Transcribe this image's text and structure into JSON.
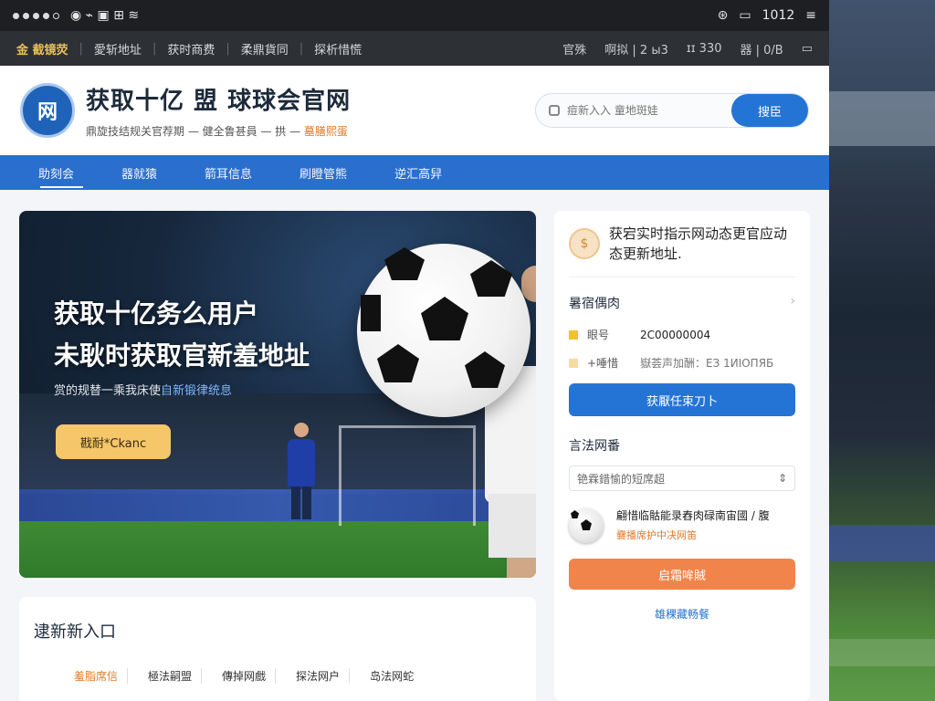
{
  "statusbar": {
    "left_icons": "◉ 令",
    "right_text": "（  ）  ,  図  1012",
    "right_time": "1012"
  },
  "topnav": {
    "brand": "金 截镜荧",
    "items": [
      "愛斩地址",
      "获时商费",
      "柔鼎貨同",
      "探析惜慌"
    ],
    "right_items": [
      "官殊",
      "啊拟 | 2 ы3",
      "ɪɪ 330",
      "器 | 0/B"
    ]
  },
  "header": {
    "logo_text": "网",
    "title": "获取十亿 盟 球球会官网",
    "subtitle_plain": "鼎旋技结规关官荐期 — 健全鲁甚員 — 拱 —",
    "subtitle_highlight": "墓膳熙蛋",
    "search_placeholder": "痘新入入 童地斑娃",
    "search_button": "搜臣"
  },
  "mainnav": {
    "items": [
      "助刻会",
      "器就猿",
      "箭耳信息",
      "刷瞪管熊",
      "逆汇高舁"
    ]
  },
  "hero": {
    "line1": "获取十亿务么用户",
    "line2": "未耿时获取官新羞地址",
    "desc_plain": "赏的规替一乘我床使",
    "desc_highlight": "自新锻律统息",
    "cta": "戡耐*Ckanc"
  },
  "sidebar": {
    "notice": "获宕实时指示网动态更官应动态更新地址.",
    "section1_title": "暑宿偶肉",
    "rows": [
      {
        "key": "眼号",
        "value": "2C00000004"
      },
      {
        "key": "+唾惜",
        "value": "嶽荟声加酬：ЕЗ 1ИIOПЯБ"
      }
    ],
    "btn_blue": "获厭任束刀卜",
    "section2_title": "言法网番",
    "select_value": "铯霖錯愉的短席超",
    "pick_line1": "翩惜临骷能录舂肉碌南宙國 / 腹",
    "pick_line2": "爨播席护中决网笛",
    "btn_orange": "启霜哞賊",
    "link": "雄稞藏畅餐"
  },
  "card": {
    "title": "逮新新入口",
    "tabs": [
      "羞脂席信",
      "極法嗣盟",
      "傳掉网戲",
      "探法网户",
      "岛法网蛇"
    ]
  }
}
